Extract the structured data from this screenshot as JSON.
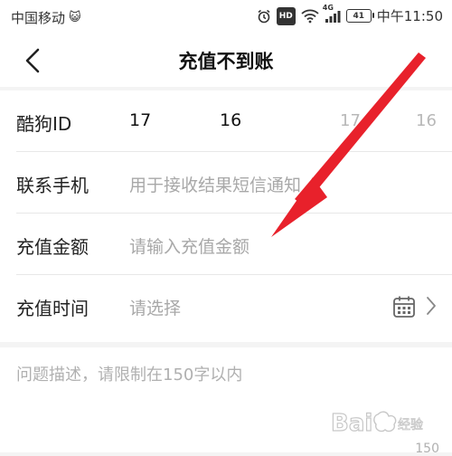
{
  "status_bar": {
    "carrier": "中国移动",
    "carrier_emoji": "😺",
    "hd_badge": "HD",
    "network": "4G",
    "battery_level": "41",
    "time": "中午11:50"
  },
  "nav": {
    "title": "充值不到账"
  },
  "form": {
    "rows": [
      {
        "label": "酷狗ID",
        "value_prefix": "17",
        "value_suffix": "16",
        "prev_prefix": "17",
        "prev_suffix": "16"
      },
      {
        "label": "联系手机",
        "placeholder": "用于接收结果短信通知"
      },
      {
        "label": "充值金额",
        "placeholder": "请输入充值金额"
      },
      {
        "label": "充值时间",
        "placeholder": "请选择"
      }
    ]
  },
  "description": {
    "placeholder": "问题描述，请限制在150字以内",
    "counter": "150"
  },
  "colors": {
    "arrow": "#e8212b",
    "placeholder": "#a8a8a8",
    "background": "#f4f4f4"
  },
  "icons": [
    "back-chevron-icon",
    "alarm-icon",
    "wifi-icon",
    "signal-icon",
    "battery-icon",
    "calendar-icon",
    "chevron-right-icon"
  ]
}
